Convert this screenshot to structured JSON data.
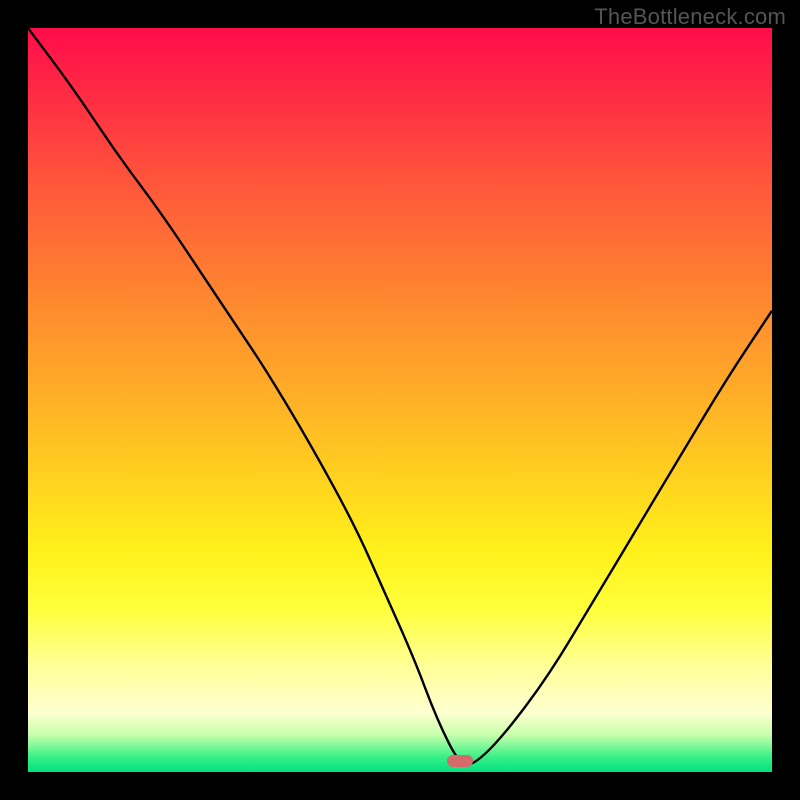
{
  "watermark": "TheBottleneck.com",
  "colors": {
    "frame_bg": "#000000",
    "curve_stroke": "#000000",
    "marker_fill": "#d46a6a",
    "gradient_top": "#ff0c4a",
    "gradient_bottom": "#00e080"
  },
  "marker": {
    "x_fraction": 0.58,
    "y_fraction": 0.985
  },
  "chart_data": {
    "type": "line",
    "title": "",
    "xlabel": "",
    "ylabel": "",
    "xlim": [
      0,
      100
    ],
    "ylim": [
      0,
      100
    ],
    "grid": false,
    "annotations": [
      {
        "text": "TheBottleneck.com",
        "position": "top-right"
      }
    ],
    "series": [
      {
        "name": "bottleneck-curve",
        "x": [
          0,
          6,
          12,
          18,
          24,
          28,
          32,
          38,
          44,
          48,
          52,
          55,
          58,
          60,
          64,
          70,
          76,
          82,
          88,
          94,
          100
        ],
        "y": [
          100,
          92,
          83,
          75,
          66,
          60,
          54,
          44,
          33,
          24,
          15,
          7,
          1,
          1,
          5,
          13,
          23,
          33,
          43,
          53,
          62
        ]
      }
    ],
    "marker_point": {
      "x": 58,
      "y": 1
    },
    "description": "V-shaped curve descending from top-left to a minimum near x≈58 then rising toward the right; background is a vertical red→green gradient; a small rounded marker sits at the curve minimum; heavy black frame around plot; no axes, ticks, or labels."
  }
}
